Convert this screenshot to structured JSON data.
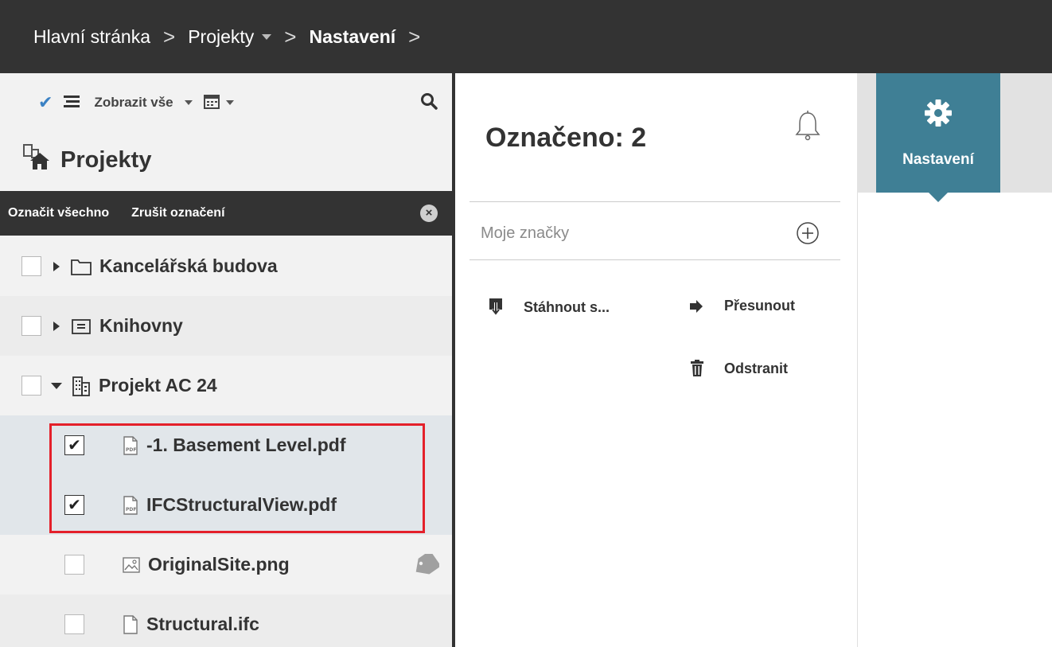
{
  "breadcrumb": {
    "items": [
      {
        "label": "Hlavní stránka"
      },
      {
        "label": "Projekty",
        "has_dropdown": true
      },
      {
        "label": "Nastavení",
        "active": true
      }
    ]
  },
  "toolbar": {
    "filter_label": "Zobrazit vše",
    "icons": [
      "check-icon",
      "list-icon",
      "calendar-icon",
      "search-icon"
    ]
  },
  "projects": {
    "title": "Projekty"
  },
  "selection_bar": {
    "select_all": "Označit všechno",
    "deselect": "Zrušit označení"
  },
  "tree": {
    "items": [
      {
        "label": "Kancelářská budova",
        "type": "folder",
        "checked": false,
        "expanded": false
      },
      {
        "label": "Knihovny",
        "type": "library",
        "checked": false,
        "expanded": false
      },
      {
        "label": "Projekt AC 24",
        "type": "project",
        "checked": false,
        "expanded": true
      },
      {
        "label": "-1. Basement Level.pdf",
        "type": "pdf",
        "checked": true
      },
      {
        "label": "IFCStructuralView.pdf",
        "type": "pdf",
        "checked": true
      },
      {
        "label": "OriginalSite.png",
        "type": "image",
        "checked": false,
        "tagged": true
      },
      {
        "label": "Structural.ifc",
        "type": "file",
        "checked": false
      }
    ]
  },
  "details": {
    "title": "Označeno: 2",
    "tags_label": "Moje značky",
    "actions": {
      "download": "Stáhnout s...",
      "move": "Přesunout",
      "delete": "Odstranit"
    }
  },
  "settings_tab": {
    "label": "Nastavení"
  },
  "colors": {
    "topbar": "#333333",
    "accent": "#3f7f95",
    "check_blue": "#3b82c4",
    "highlight_red": "#e4202a"
  }
}
